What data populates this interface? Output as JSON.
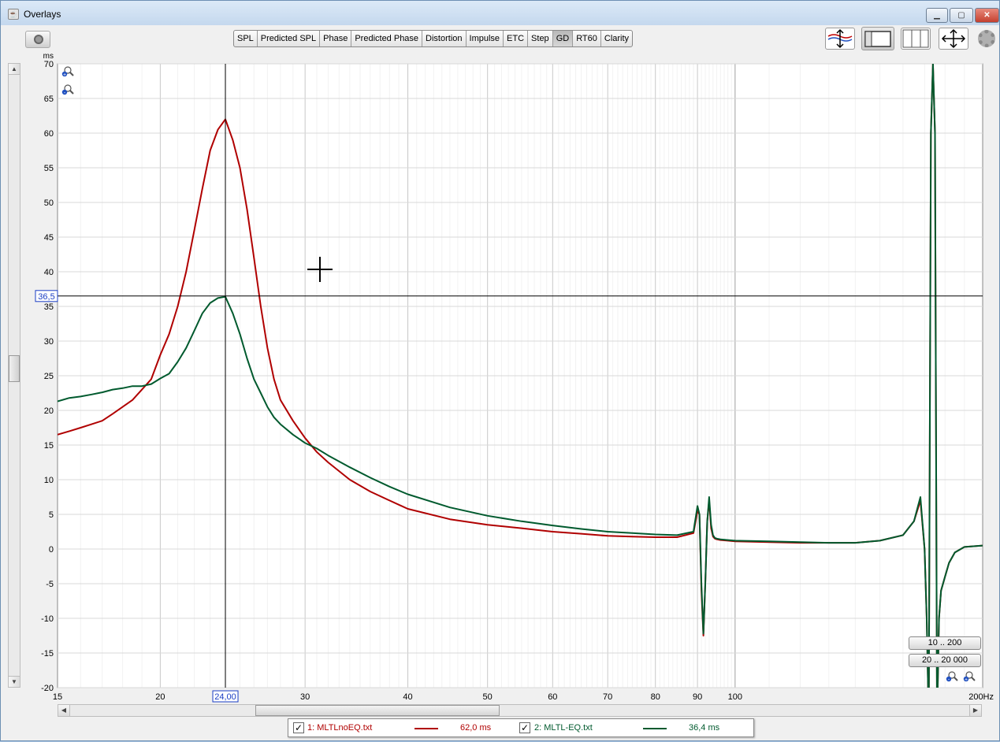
{
  "window": {
    "title": "Overlays",
    "controls": {
      "minimize": "▁",
      "maximize": "▢",
      "close": "✕"
    }
  },
  "toolbar": {
    "tabs": [
      {
        "label": "SPL"
      },
      {
        "label": "Predicted SPL"
      },
      {
        "label": "Phase"
      },
      {
        "label": "Predicted Phase"
      },
      {
        "label": "Distortion"
      },
      {
        "label": "Impulse"
      },
      {
        "label": "ETC"
      },
      {
        "label": "Step"
      },
      {
        "label": "GD",
        "active": true
      },
      {
        "label": "RT60"
      },
      {
        "label": "Clarity"
      }
    ],
    "icons": [
      "camera-icon",
      "axes-limits-icon",
      "window-layout-icon",
      "columns-icon",
      "pan-icon",
      "gear-icon"
    ]
  },
  "scrollbars": {
    "up": "▲",
    "down": "▼",
    "left": "◀",
    "right": "▶"
  },
  "range_buttons": {
    "r1": "10 .. 200",
    "r2": "20 .. 20 000"
  },
  "cursor": {
    "x_value": 24,
    "y_value": 36.5,
    "x_label": "24,00",
    "y_label": "36,5"
  },
  "legend": {
    "items": [
      {
        "checked": "✓",
        "name": "1: MLTLnoEQ.txt",
        "value": "62,0 ms",
        "color": "#b00000"
      },
      {
        "checked": "✓",
        "name": "2: MLTL-EQ.txt",
        "value": "36,4 ms",
        "color": "#005a2e"
      }
    ]
  },
  "chart_data": {
    "type": "line",
    "title": "",
    "xlabel": "",
    "ylabel": "ms",
    "x_unit": "Hz",
    "x_scale": "log",
    "xlim": [
      15,
      200
    ],
    "ylim": [
      -20,
      70
    ],
    "x_ticks": [
      15,
      20,
      30,
      40,
      50,
      60,
      70,
      80,
      90,
      100,
      200
    ],
    "x_tick_labels": [
      "15",
      "20",
      "30",
      "40",
      "50",
      "60",
      "70",
      "80",
      "90",
      "100",
      "200Hz"
    ],
    "y_ticks": [
      70,
      65,
      60,
      55,
      50,
      45,
      40,
      35,
      30,
      25,
      20,
      15,
      10,
      5,
      0,
      -5,
      -10,
      -15,
      -20
    ],
    "grid": true,
    "series": [
      {
        "name": "1: MLTLnoEQ.txt",
        "color": "#b00000",
        "x": [
          15,
          15.5,
          16,
          16.5,
          17,
          17.5,
          18,
          18.5,
          19,
          19.5,
          20,
          20.5,
          21,
          21.5,
          22,
          22.5,
          23,
          23.5,
          24,
          24.5,
          25,
          25.5,
          26,
          26.5,
          27,
          27.5,
          28,
          29,
          30,
          31,
          32,
          34,
          36,
          38,
          40,
          45,
          50,
          55,
          60,
          65,
          70,
          75,
          80,
          85,
          89,
          90,
          90.5,
          91,
          91.5,
          92,
          92.5,
          93,
          93.5,
          94,
          94.5,
          95,
          96,
          98,
          100,
          110,
          120,
          130,
          140,
          150,
          160,
          165,
          168,
          170,
          171,
          172,
          173,
          174,
          175,
          176,
          177,
          178,
          180,
          182,
          185,
          190,
          195,
          200
        ],
        "y": [
          16.5,
          17,
          17.5,
          18,
          18.5,
          19.5,
          20.5,
          21.5,
          23,
          24.5,
          28,
          31,
          35,
          40,
          46,
          52,
          57.5,
          60.5,
          62,
          59,
          55,
          49,
          42,
          35,
          29,
          24.5,
          21.5,
          18.5,
          16,
          14,
          12.5,
          10,
          8.3,
          7,
          5.8,
          4.3,
          3.5,
          3,
          2.5,
          2.2,
          1.9,
          1.8,
          1.7,
          1.7,
          2.3,
          5.5,
          5,
          -6,
          -12.5,
          -5,
          4,
          7,
          3,
          1.8,
          1.5,
          1.4,
          1.3,
          1.2,
          1.1,
          1,
          0.9,
          0.9,
          0.9,
          1.2,
          2,
          4,
          7,
          0,
          -10,
          -25,
          60,
          70,
          60,
          -25,
          -10,
          -6,
          -4,
          -2,
          -0.5,
          0.3,
          0.4,
          0.5
        ]
      },
      {
        "name": "2: MLTL-EQ.txt",
        "color": "#005a2e",
        "x": [
          15,
          15.5,
          16,
          16.5,
          17,
          17.5,
          18,
          18.5,
          19,
          19.5,
          20,
          20.5,
          21,
          21.5,
          22,
          22.5,
          23,
          23.5,
          24,
          24.5,
          25,
          25.5,
          26,
          26.5,
          27,
          27.5,
          28,
          29,
          30,
          31,
          32,
          34,
          36,
          38,
          40,
          45,
          50,
          55,
          60,
          65,
          70,
          75,
          80,
          85,
          89,
          90,
          90.5,
          91,
          91.5,
          92,
          92.5,
          93,
          93.5,
          94,
          94.5,
          95,
          96,
          98,
          100,
          110,
          120,
          130,
          140,
          150,
          160,
          165,
          168,
          170,
          171,
          172,
          173,
          174,
          175,
          176,
          177,
          178,
          180,
          182,
          185,
          190,
          195,
          200
        ],
        "y": [
          21.3,
          21.8,
          22,
          22.3,
          22.6,
          23,
          23.2,
          23.5,
          23.5,
          23.8,
          24.6,
          25.3,
          27,
          29,
          31.5,
          34,
          35.5,
          36.2,
          36.4,
          34,
          31,
          27.5,
          24.5,
          22.5,
          20.5,
          19,
          18,
          16.5,
          15.3,
          14.5,
          13.5,
          11.8,
          10.3,
          9,
          7.9,
          6,
          4.8,
          4,
          3.4,
          2.9,
          2.5,
          2.3,
          2.1,
          2,
          2.5,
          6.2,
          5,
          -5,
          -12.2,
          -5,
          4,
          7.5,
          3.5,
          2,
          1.6,
          1.5,
          1.4,
          1.3,
          1.2,
          1.1,
          1,
          0.9,
          0.9,
          1.2,
          2,
          4,
          7.5,
          0,
          -10,
          -25,
          60,
          70,
          60,
          -25,
          -10,
          -6,
          -4,
          -2,
          -0.5,
          0.3,
          0.4,
          0.5
        ]
      }
    ]
  }
}
